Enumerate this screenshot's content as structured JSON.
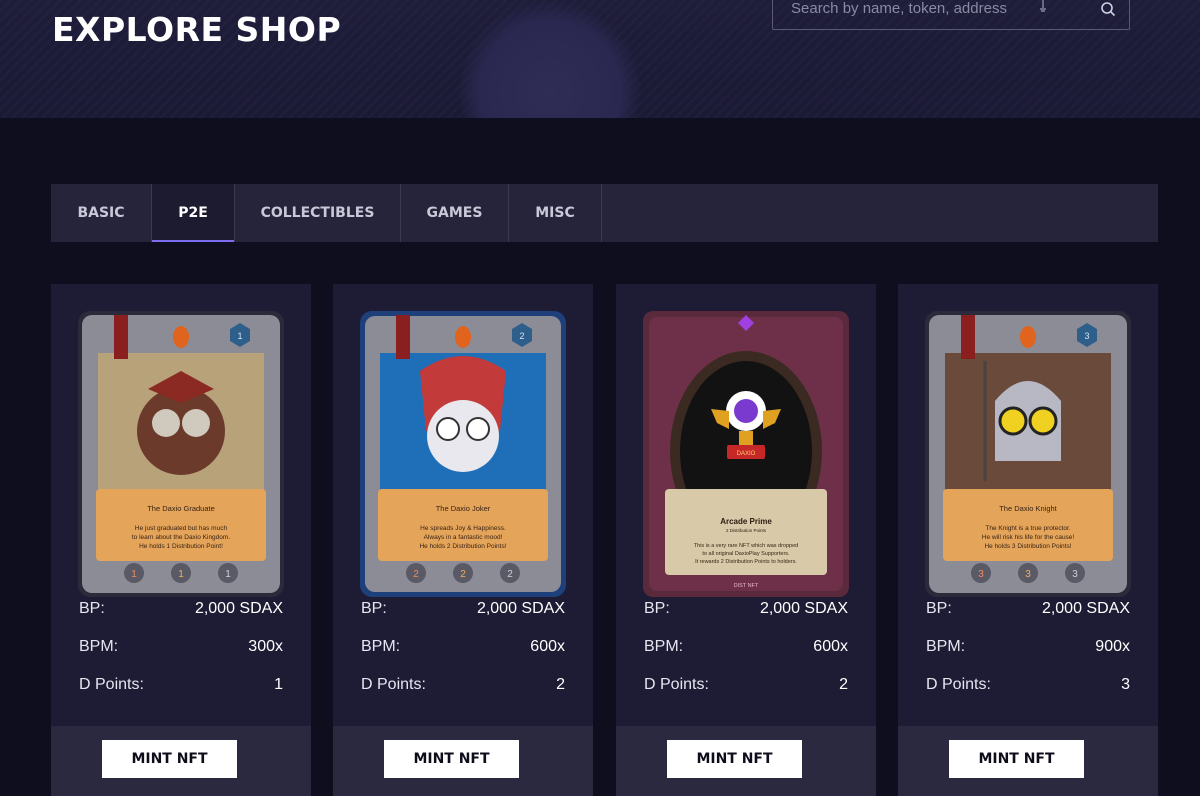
{
  "header": {
    "title": "EXPLORE SHOP",
    "search_placeholder": "Search by name, token, address"
  },
  "tabs": [
    {
      "label": "BASIC",
      "active": false
    },
    {
      "label": "P2E",
      "active": true
    },
    {
      "label": "COLLECTIBLES",
      "active": false
    },
    {
      "label": "GAMES",
      "active": false
    },
    {
      "label": "MISC",
      "active": false
    }
  ],
  "colors": {
    "background": "#0f0e1f",
    "card_background": "#1d1c34",
    "tab_indicator": "#7b6cf0",
    "button_background": "#ffffff"
  },
  "cards": [
    {
      "name": "The Daxio Graduate",
      "description": [
        "He just graduated but has much",
        "to learn about the Daxio Kingdom.",
        "He holds 1 Distribution Point!"
      ],
      "frame": "blue",
      "art": "owl-graduate",
      "gem_number": "1",
      "badges": [
        "1",
        "1",
        "1"
      ],
      "bp_label": "BP:",
      "bp_value": "2,000 SDAX",
      "bpm_label": "BPM:",
      "bpm_value": "300x",
      "dpoints_label": "D Points:",
      "dpoints_value": "1",
      "button_label": "MINT NFT"
    },
    {
      "name": "The Daxio Joker",
      "description": [
        "He spreads Joy & Happiness.",
        "Always in a fantastic mood!",
        "He holds 2 Distribution Points!"
      ],
      "frame": "blue",
      "art": "owl-joker",
      "gem_number": "2",
      "badges": [
        "2",
        "2",
        "2"
      ],
      "bp_label": "BP:",
      "bp_value": "2,000 SDAX",
      "bpm_label": "BPM:",
      "bpm_value": "600x",
      "dpoints_label": "D Points:",
      "dpoints_value": "2",
      "button_label": "MINT NFT"
    },
    {
      "name": "Arcade Prime",
      "subtitle": "2 Distribution Points",
      "description": [
        "This is a very rare NFT which was dropped",
        "to all original DaxioPlay Supporters.",
        "It rewards 2 Distribution Points to holders."
      ],
      "footer_tag": "DIST NFT",
      "trophy_text": "DAXIO",
      "frame": "purple",
      "art": "trophy",
      "bp_label": "BP:",
      "bp_value": "2,000 SDAX",
      "bpm_label": "BPM:",
      "bpm_value": "600x",
      "dpoints_label": "D Points:",
      "dpoints_value": "2",
      "button_label": "MINT NFT"
    },
    {
      "name": "The Daxio Knight",
      "description": [
        "The Knight is a true protector.",
        "He will risk his life for the cause!",
        "He holds 3 Distribution Points!"
      ],
      "frame": "blue",
      "art": "owl-knight",
      "gem_number": "3",
      "badges": [
        "3",
        "3",
        "3"
      ],
      "bp_label": "BP:",
      "bp_value": "2,000 SDAX",
      "bpm_label": "BPM:",
      "bpm_value": "900x",
      "dpoints_label": "D Points:",
      "dpoints_value": "3",
      "button_label": "MINT NFT"
    }
  ]
}
